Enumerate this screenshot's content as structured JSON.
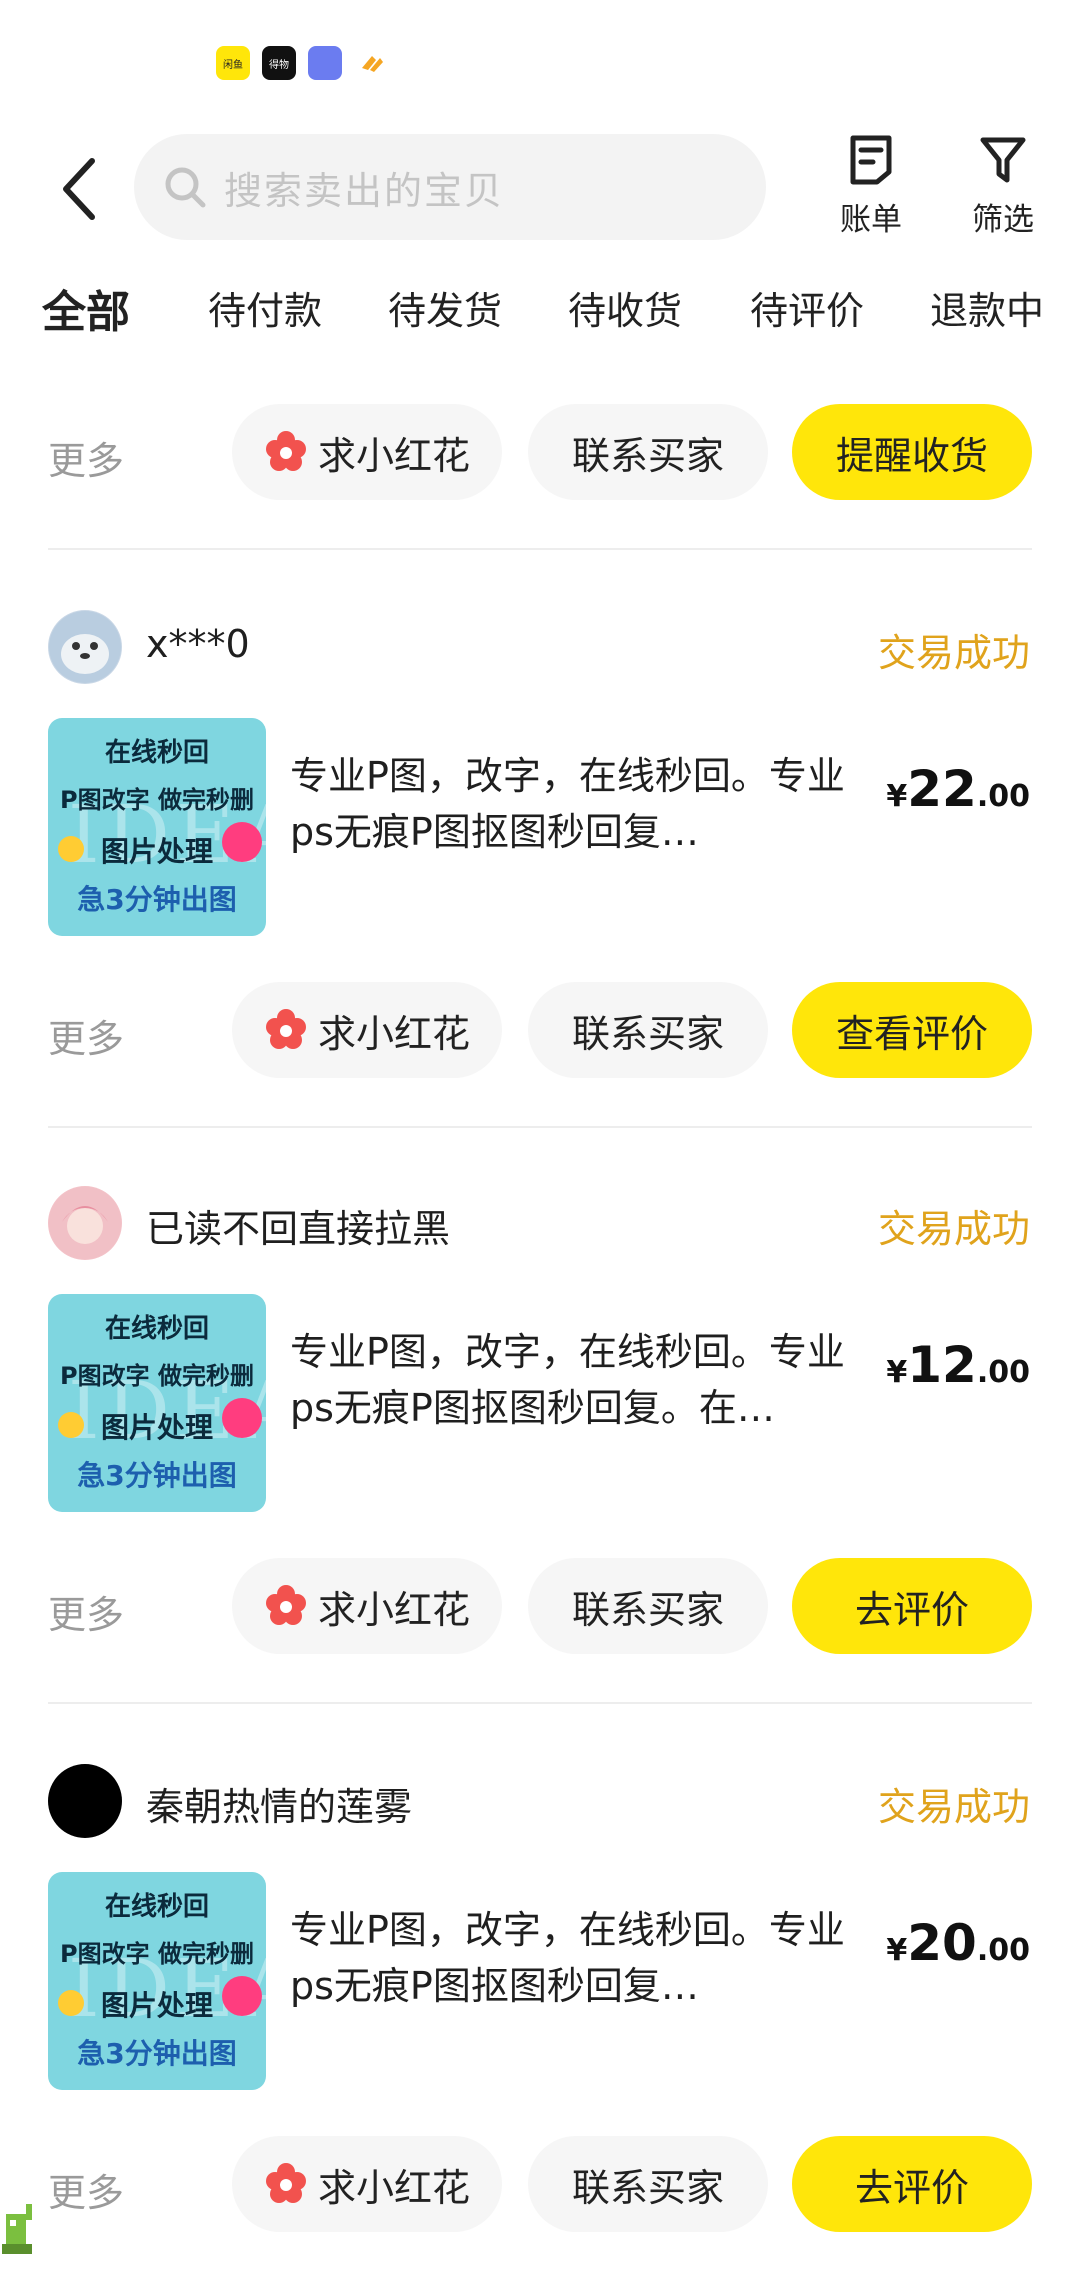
{
  "status_bar": {
    "icons": [
      "闲鱼",
      "得物",
      "app-icon",
      "app-icon"
    ]
  },
  "header": {
    "search_placeholder": "搜索卖出的宝贝",
    "bill_label": "账单",
    "filter_label": "筛选"
  },
  "tabs": [
    "全部",
    "待付款",
    "待发货",
    "待收货",
    "待评价",
    "退款中"
  ],
  "common": {
    "more": "更多",
    "flower": "求小红花",
    "contact": "联系买家"
  },
  "top_row": {
    "primary": "提醒收货"
  },
  "thumbnail": {
    "line1": "在线秒回",
    "line2": "P图改字 做完秒删",
    "line3": "图片处理",
    "line4": "急3分钟出图",
    "watermark": "IDEA"
  },
  "orders": [
    {
      "buyer": "x***0",
      "status": "交易成功",
      "title": "专业P图，改字，在线秒回。专业ps无痕P图抠图秒回复…",
      "price_int": "22",
      "price_dec": ".00",
      "primary": "查看评价"
    },
    {
      "buyer": "已读不回直接拉黑",
      "status": "交易成功",
      "title": "专业P图，改字，在线秒回。专业ps无痕P图抠图秒回复。在…",
      "price_int": "12",
      "price_dec": ".00",
      "primary": "去评价"
    },
    {
      "buyer": "秦朝热情的莲雾",
      "status": "交易成功",
      "title": "专业P图，改字，在线秒回。专业ps无痕P图抠图秒回复…",
      "price_int": "20",
      "price_dec": ".00",
      "primary": "去评价"
    }
  ],
  "currency": "¥",
  "colors": {
    "accent": "#ffe60a",
    "status": "#e0a31c",
    "flower": "#f2524e"
  }
}
